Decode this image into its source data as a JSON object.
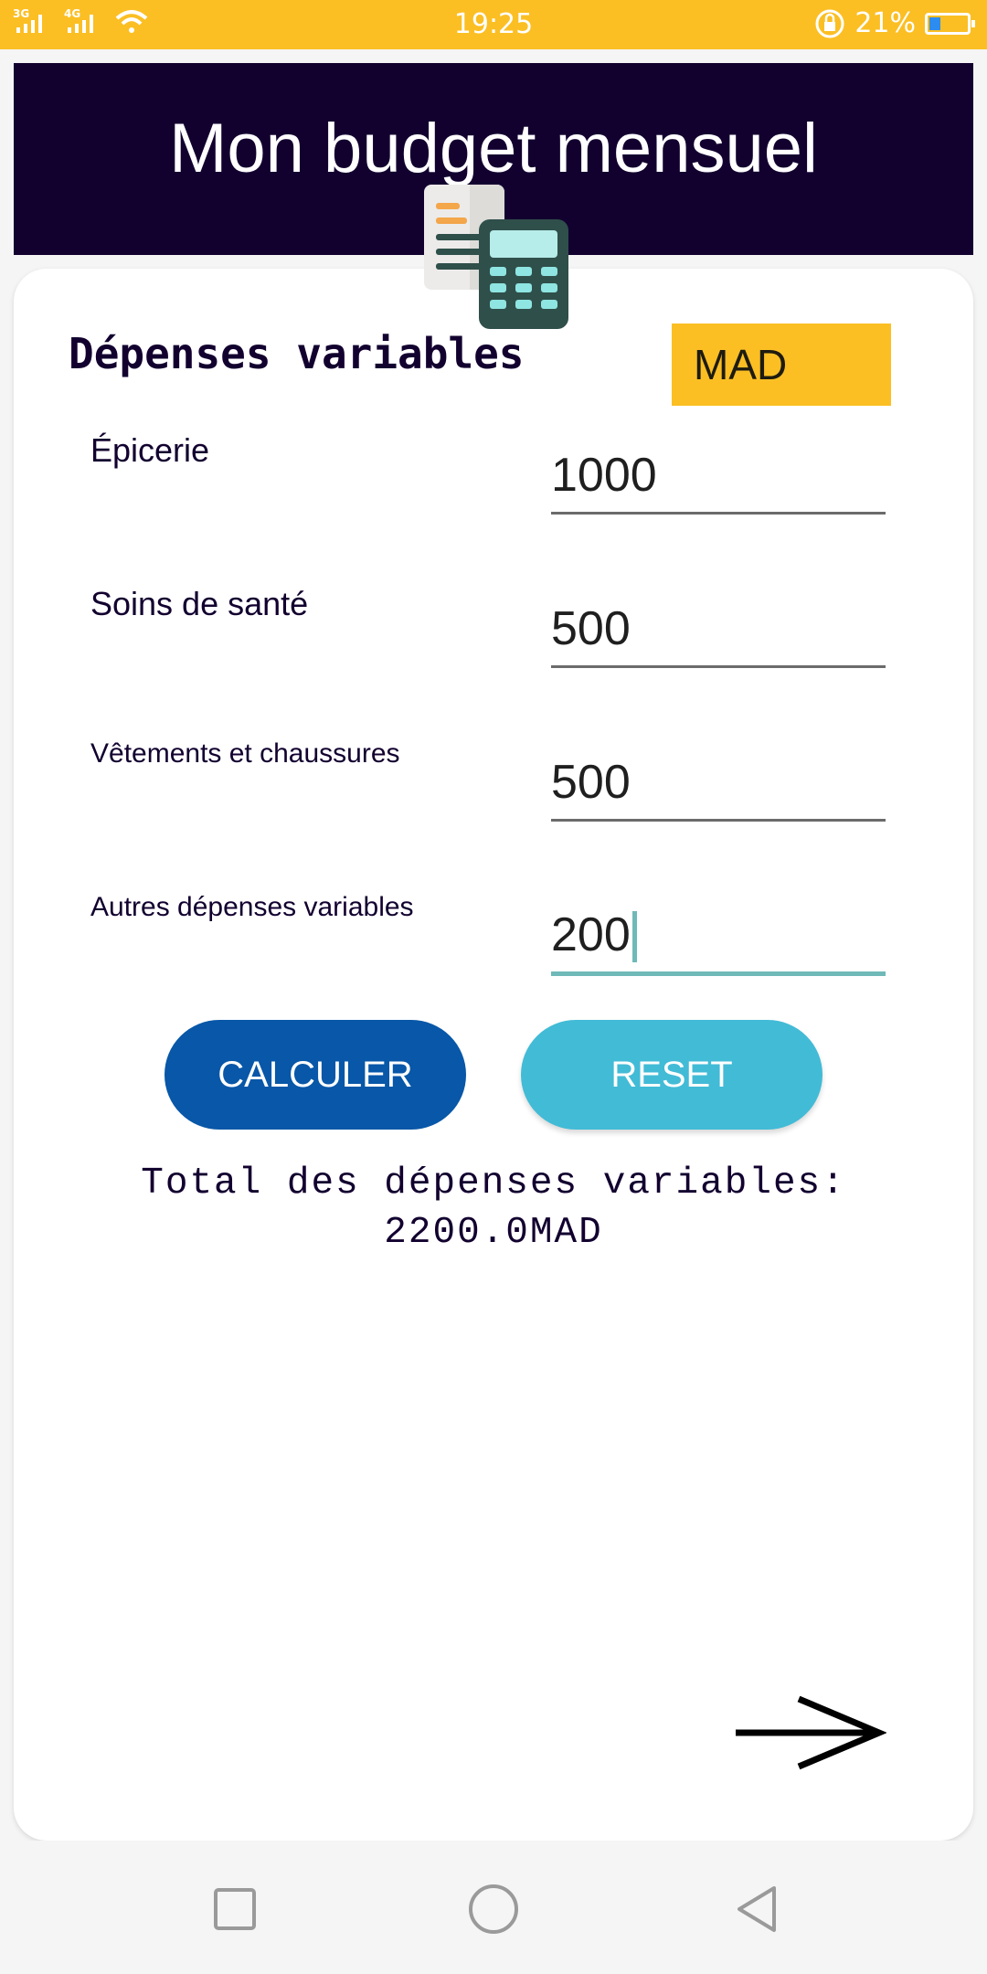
{
  "status_bar": {
    "network_left": "3G",
    "network_right": "4G",
    "time": "19:25",
    "battery_percent": "21%",
    "colors": {
      "background": "#fbbf24"
    }
  },
  "header": {
    "title": "Mon budget mensuel",
    "background": "#12002f"
  },
  "logo": {
    "icon": "calculator-document-icon"
  },
  "section": {
    "title": "Dépenses variables",
    "currency": "MAD"
  },
  "rows": [
    {
      "label": "Épicerie",
      "value": "1000"
    },
    {
      "label": "Soins de santé",
      "value": "500"
    },
    {
      "label": "Vêtements et chaussures",
      "value": "500"
    },
    {
      "label": "Autres dépenses variables",
      "value": "200"
    }
  ],
  "buttons": {
    "calculate": "CALCULER",
    "reset": "RESET"
  },
  "total": {
    "line1": "Total des dépenses variables:",
    "line2": "2200.0MAD"
  },
  "nav": {
    "recent": "square-icon",
    "home": "circle-icon",
    "back": "triangle-back-icon",
    "next": "arrow-right-icon"
  }
}
